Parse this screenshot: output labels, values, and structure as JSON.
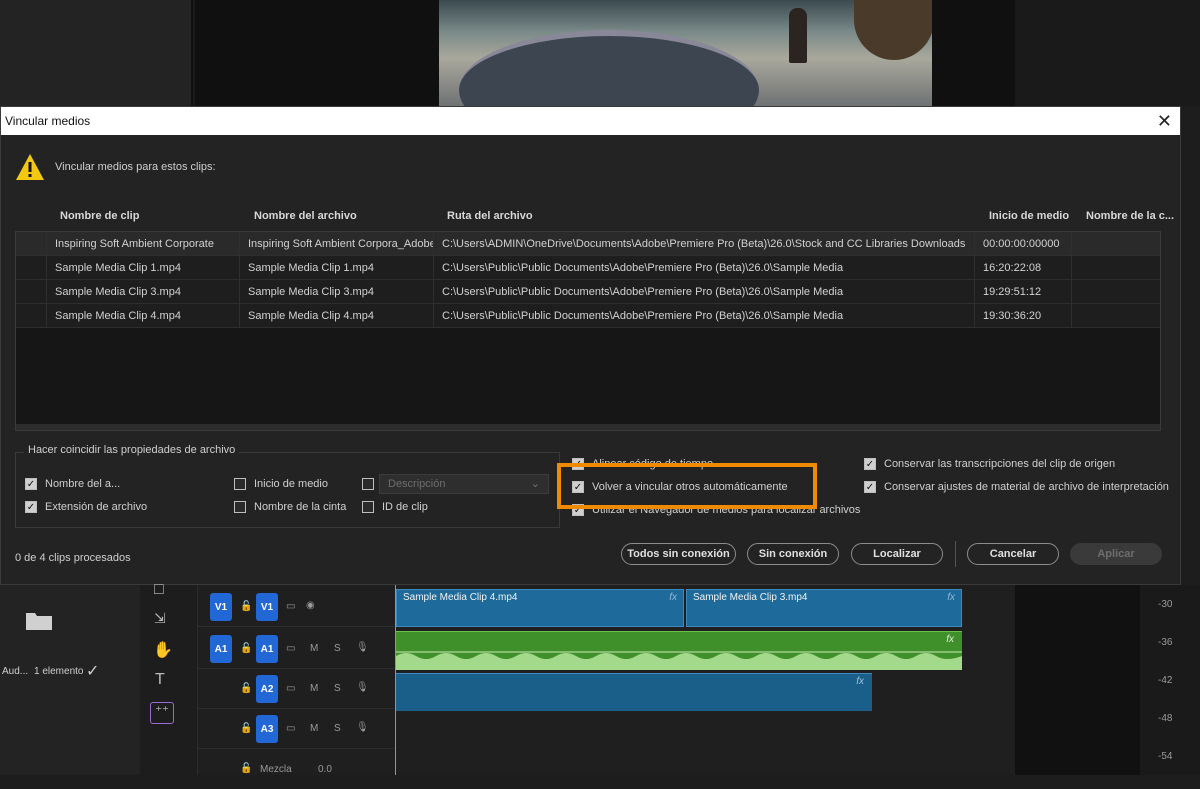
{
  "dialog": {
    "title": "Vincular medios",
    "message": "Vincular medios para estos clips:",
    "columns": [
      "Nombre de clip",
      "Nombre del archivo",
      "Ruta del archivo",
      "Inicio de medio",
      "Nombre de la c..."
    ],
    "rows": [
      {
        "clip": "Inspiring Soft Ambient Corporate",
        "file": "Inspiring Soft Ambient Corpora_Adobe",
        "path": "C:\\Users\\ADMIN\\OneDrive\\Documents\\Adobe\\Premiere Pro (Beta)\\26.0\\Stock and CC Libraries Downloads",
        "start": "00:00:00:00000"
      },
      {
        "clip": "Sample Media Clip 1.mp4",
        "file": "Sample Media Clip 1.mp4",
        "path": "C:\\Users\\Public\\Public Documents\\Adobe\\Premiere Pro (Beta)\\26.0\\Sample Media",
        "start": "16:20:22:08"
      },
      {
        "clip": "Sample Media Clip 3.mp4",
        "file": "Sample Media Clip 3.mp4",
        "path": "C:\\Users\\Public\\Public Documents\\Adobe\\Premiere Pro (Beta)\\26.0\\Sample Media",
        "start": "19:29:51:12"
      },
      {
        "clip": "Sample Media Clip 4.mp4",
        "file": "Sample Media Clip 4.mp4",
        "path": "C:\\Users\\Public\\Public Documents\\Adobe\\Premiere Pro (Beta)\\26.0\\Sample Media",
        "start": "19:30:36:20"
      }
    ],
    "match_group": {
      "title": "Hacer coincidir las propiedades de archivo",
      "opt_nombre": "Nombre del a...",
      "opt_extension": "Extensión de archivo",
      "opt_inicio": "Inicio de medio",
      "opt_cinta": "Nombre de la cinta",
      "opt_id": "ID de clip",
      "desc_placeholder": "Descripción"
    },
    "options": {
      "align": "Alinear código de tiempo",
      "relink_auto": "Volver a vincular otros automáticamente",
      "navigator": "Utilizar el Navegador de medios para localizar archivos",
      "keep_transcripts": "Conservar las transcripciones del clip de origen",
      "keep_interp": "Conservar ajustes de material de archivo de interpretación"
    },
    "status": "0 de 4 clips procesados",
    "buttons": {
      "all_offline": "Todos sin conexión",
      "offline": "Sin conexión",
      "locate": "Localizar",
      "cancel": "Cancelar",
      "apply": "Aplicar"
    }
  },
  "timeline": {
    "project_label": "Aud...",
    "project_count": "1 elemento",
    "tracks": {
      "v1": "V1",
      "a1": "A1",
      "a2": "A2",
      "a3": "A3",
      "m": "M",
      "s": "S"
    },
    "mix_label": "Mezcla",
    "mix_value": "0.0",
    "clip_v1a": "Sample Media Clip 4.mp4",
    "clip_v1b": "Sample Media Clip 3.mp4",
    "fx": "fx",
    "meter_ticks": [
      "-30",
      "-36",
      "-42",
      "-48",
      "-54"
    ]
  },
  "colors": {
    "accent": "#2168d6",
    "highlight": "#f08a00",
    "audio": "#3f8f2a",
    "video": "#1e6a9a"
  }
}
